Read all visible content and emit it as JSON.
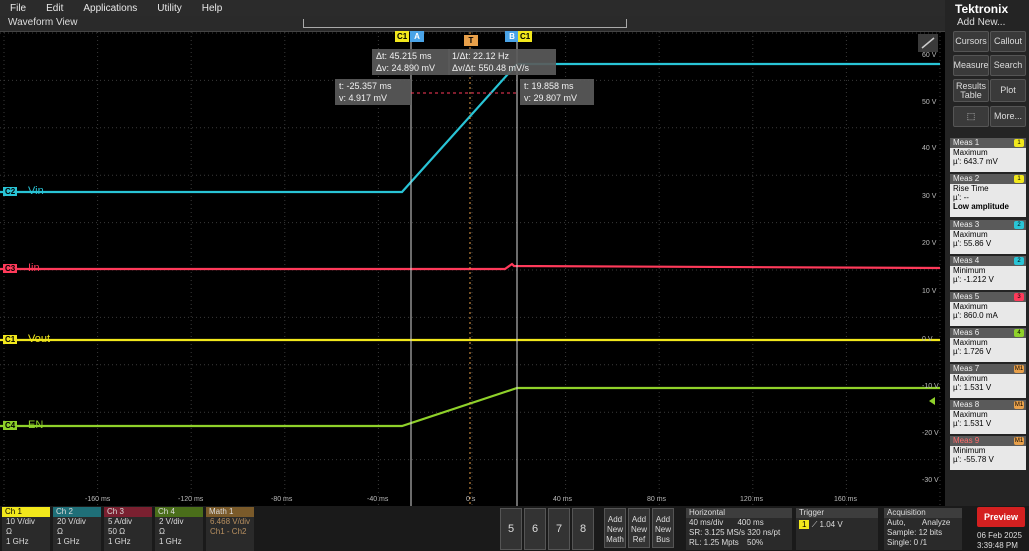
{
  "menu": [
    "File",
    "Edit",
    "Applications",
    "Utility",
    "Help"
  ],
  "window_title": "Waveform View",
  "brand": "Tektronix",
  "add_new": "Add New...",
  "right_buttons": [
    "Cursors",
    "Callout",
    "Measure",
    "Search",
    "Results Table",
    "Plot",
    "More..."
  ],
  "readouts": {
    "delta": [
      "Δt: 45.215 ms",
      "Δv: 24.890 mV"
    ],
    "freq": [
      "1/Δt: 22.12 Hz",
      "Δv/Δt: 550.48 mV/s"
    ],
    "cursorA": [
      "t: -25.357 ms",
      "v: 4.917 mV"
    ],
    "cursorB": [
      "t: 19.858 ms",
      "v: 29.807 mV"
    ]
  },
  "markers": {
    "c1a": "C1",
    "a": "A",
    "b": "B",
    "c1b": "C1",
    "t": "T"
  },
  "channels": [
    {
      "tag": "C2",
      "name": "Vin",
      "color": "#29c4d6"
    },
    {
      "tag": "C3",
      "name": "Iin",
      "color": "#ff3a5a"
    },
    {
      "tag": "C1",
      "name": "Vout",
      "color": "#f2e81c"
    },
    {
      "tag": "C4",
      "name": "EN",
      "color": "#8fd12a"
    }
  ],
  "vaxis": [
    "60 V",
    "50 V",
    "40 V",
    "30 V",
    "20 V",
    "10 V",
    "0 V",
    "-10 V",
    "-20 V",
    "-30 V"
  ],
  "taxis": [
    "-160 ms",
    "-120 ms",
    "-80 ms",
    "-40 ms",
    "0 s",
    "40 ms",
    "80 ms",
    "120 ms",
    "160 ms"
  ],
  "meas": [
    {
      "head": "Meas 1",
      "tag": "1",
      "tagcolor": "#f2e81c",
      "l1": "Maximum",
      "l2": "µ': 643.7 mV",
      "l3": ""
    },
    {
      "head": "Meas 2",
      "tag": "1",
      "tagcolor": "#f2e81c",
      "l1": "Rise Time",
      "l2": "µ': --",
      "l3": "Low amplitude"
    },
    {
      "head": "Meas 3",
      "tag": "2",
      "tagcolor": "#29c4d6",
      "l1": "Maximum",
      "l2": "µ': 55.86 V",
      "l3": ""
    },
    {
      "head": "Meas 4",
      "tag": "2",
      "tagcolor": "#29c4d6",
      "l1": "Minimum",
      "l2": "µ': -1.212 V",
      "l3": ""
    },
    {
      "head": "Meas 5",
      "tag": "3",
      "tagcolor": "#ff3a5a",
      "l1": "Maximum",
      "l2": "µ': 860.0 mA",
      "l3": ""
    },
    {
      "head": "Meas 6",
      "tag": "4",
      "tagcolor": "#8fd12a",
      "l1": "Maximum",
      "l2": "µ': 1.726 V",
      "l3": ""
    },
    {
      "head": "Meas 7",
      "tag": "M1",
      "tagcolor": "#e8a04a",
      "l1": "Maximum",
      "l2": "µ': 1.531 V",
      "l3": ""
    },
    {
      "head": "Meas 8",
      "tag": "M1",
      "tagcolor": "#e8a04a",
      "l1": "Maximum",
      "l2": "µ': 1.531 V",
      "l3": ""
    },
    {
      "head": "Meas 9",
      "tag": "M1",
      "tagcolor": "#e8a04a",
      "l1": "Minimum",
      "l2": "µ': -55.78 V",
      "l3": ""
    }
  ],
  "ch_boxes": [
    {
      "hdr": "Ch 1",
      "color": "#f2e81c",
      "l1": "10 V/div",
      "l2": "Ω",
      "l3": "1 GHz"
    },
    {
      "hdr": "Ch 2",
      "color": "#29c4d6",
      "l1": "20 V/div",
      "l2": "Ω",
      "l3": "1 GHz"
    },
    {
      "hdr": "Ch 3",
      "color": "#ff3a5a",
      "l1": "5 A/div",
      "l2": "50 Ω",
      "l3": "1 GHz"
    },
    {
      "hdr": "Ch 4",
      "color": "#8fd12a",
      "l1": "2 V/div",
      "l2": "Ω",
      "l3": "1 GHz"
    },
    {
      "hdr": "Math 1",
      "color": "#e8a04a",
      "l1": "6.468 V/div",
      "l2": "Ch1 - Ch2",
      "l3": ""
    }
  ],
  "num_buttons": [
    "5",
    "6",
    "7",
    "8"
  ],
  "add_buttons": [
    [
      "Add",
      "New",
      "Math"
    ],
    [
      "Add",
      "New",
      "Ref"
    ],
    [
      "Add",
      "New",
      "Bus"
    ]
  ],
  "horizontal": {
    "hdr": "Horizontal",
    "l1a": "40 ms/div",
    "l1b": "400 ms",
    "l2a": "SR: 3.125 MS/s",
    "l2b": "320 ns/pt",
    "l3a": "RL: 1.25 Mpts",
    "l3b": "50%"
  },
  "trigger": {
    "hdr": "Trigger",
    "ch": "1",
    "level": "1.04 V"
  },
  "acquisition": {
    "hdr": "Acquisition",
    "l1a": "Auto,",
    "l1b": "Analyze",
    "l2": "Sample: 12 bits",
    "l3": "Single: 0 /1"
  },
  "preview": "Preview",
  "date": "06 Feb 2025",
  "time": "3:39:48 PM"
}
